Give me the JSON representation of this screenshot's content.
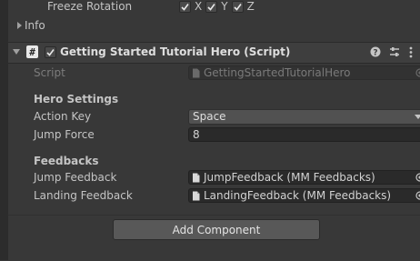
{
  "top_rows": {
    "freeze_rotation_label": "Freeze Rotation",
    "axes": [
      "X",
      "Y",
      "Z"
    ],
    "info_label": "Info"
  },
  "component": {
    "title": "Getting Started Tutorial Hero (Script)",
    "script_label": "Script",
    "script_value": "GettingStartedTutorialHero"
  },
  "hero_settings": {
    "heading": "Hero Settings",
    "action_key_label": "Action Key",
    "action_key_value": "Space",
    "jump_force_label": "Jump Force",
    "jump_force_value": "8"
  },
  "feedbacks": {
    "heading": "Feedbacks",
    "jump_label": "Jump Feedback",
    "jump_value": "JumpFeedback (MM Feedbacks)",
    "landing_label": "Landing Feedback",
    "landing_value": "LandingFeedback (MM Feedbacks)"
  },
  "add_component_label": "Add Component",
  "icons": {
    "foldout": "triangle-icon",
    "script": "hash-script-icon",
    "help": "help-icon",
    "presets": "sliders-icon",
    "more": "kebab-menu-icon",
    "object_picker": "target-circle-icon",
    "asset": "document-icon"
  }
}
